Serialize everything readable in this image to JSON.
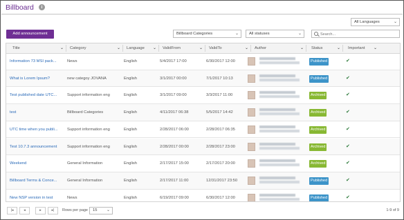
{
  "page": {
    "title": "Billboard",
    "info_icon": "i"
  },
  "toolbar": {
    "language_select": "All Languages",
    "add_label": "Add announcement",
    "category_select": "Billboard Categories",
    "status_select": "All statuses",
    "search_placeholder": "Search..."
  },
  "table": {
    "columns": [
      "Title",
      "Category",
      "Language",
      "ValidFrom",
      "ValidTo",
      "Author",
      "Status",
      "Important"
    ],
    "rows": [
      {
        "title": "Information 73 MSI pack...",
        "category": "News",
        "language": "English",
        "valid_from": "5/4/2017 17:00",
        "valid_to": "6/30/2017 12:00",
        "status": "Published",
        "important": "✔"
      },
      {
        "title": "What is Lorem Ipsum?",
        "category": "new categoy JOVANA",
        "language": "English",
        "valid_from": "3/1/2017 00:00",
        "valid_to": "7/1/2017 10:13",
        "status": "Published",
        "important": "✔"
      },
      {
        "title": "Test published date UTC...",
        "category": "Support information eng",
        "language": "English",
        "valid_from": "3/1/2017 09:00",
        "valid_to": "3/3/2017 11:00",
        "status": "Archived",
        "important": "✔"
      },
      {
        "title": "test",
        "category": "Billboard Categories",
        "language": "English",
        "valid_from": "4/11/2017 06:38",
        "valid_to": "5/5/2017 14:42",
        "status": "Archived",
        "important": "✔"
      },
      {
        "title": "UTC time when you publi...",
        "category": "Support information eng",
        "language": "English",
        "valid_from": "2/28/2017 06:00",
        "valid_to": "2/28/2017 06:35",
        "status": "Archived",
        "important": "✔"
      },
      {
        "title": "Test 10.7.3 announcement",
        "category": "Support information eng",
        "language": "English",
        "valid_from": "2/28/2017 00:00",
        "valid_to": "2/28/2017 23:00",
        "status": "Archived",
        "important": "✔"
      },
      {
        "title": "Weekend",
        "category": "General Information",
        "language": "English",
        "valid_from": "2/17/2017 15:00",
        "valid_to": "2/17/2017 20:00",
        "status": "Archived",
        "important": "✔"
      },
      {
        "title": "Billboard Terms & Conce...",
        "category": "General Information",
        "language": "English",
        "valid_from": "2/17/2017 11:00",
        "valid_to": "12/31/2017 23:50",
        "status": "Published",
        "important": "✔"
      },
      {
        "title": "New NSP version in test",
        "category": "News",
        "language": "English",
        "valid_from": "6/19/2017 09:00",
        "valid_to": "6/30/2017 12:00",
        "status": "Published",
        "important": "✔"
      }
    ]
  },
  "pager": {
    "first": "|◂",
    "prev": "◂",
    "next": "▸",
    "last": "▸|",
    "rows_per_page_label": "Rows per page",
    "rows_per_page_value": "15",
    "count": "1-9 of 9"
  },
  "colors": {
    "brand": "#6f2e94",
    "published": "#3d94c9",
    "archived": "#88b833",
    "link": "#2a6ab8"
  }
}
